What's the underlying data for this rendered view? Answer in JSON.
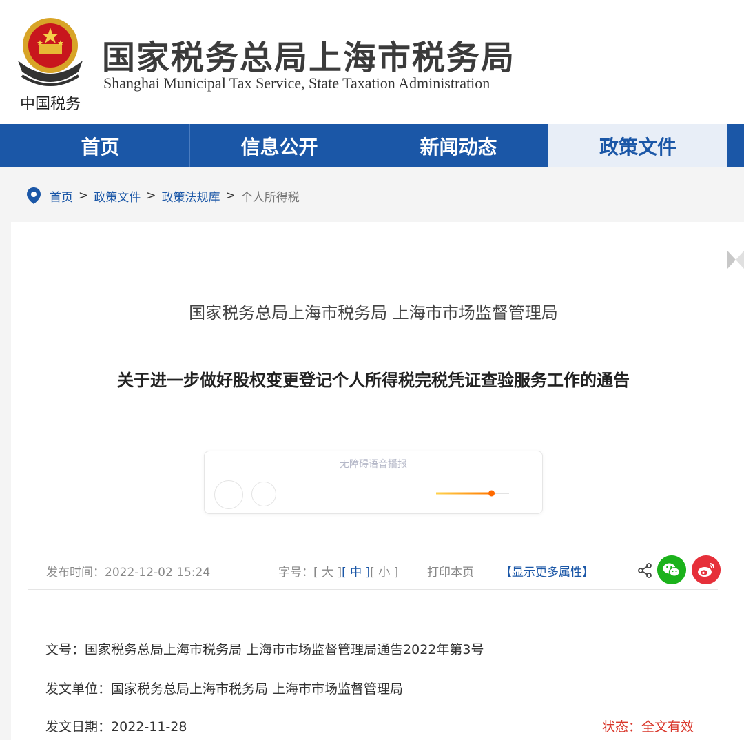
{
  "header": {
    "emblem_caption": "中国税务",
    "title": "国家税务总局上海市税务局",
    "subtitle": "Shanghai Municipal Tax Service, State Taxation Administration"
  },
  "nav": {
    "items": [
      {
        "label": "首页"
      },
      {
        "label": "信息公开"
      },
      {
        "label": "新闻动态"
      },
      {
        "label": "政策文件"
      }
    ],
    "active_index": 3
  },
  "breadcrumb": {
    "items": [
      "首页",
      "政策文件",
      "政策法规库"
    ],
    "separator": ">",
    "current": "个人所得税"
  },
  "article": {
    "issuer": "国家税务总局上海市税务局 上海市市场监督管理局",
    "title": "关于进一步做好股权变更登记个人所得税完税凭证查验服务工作的通告",
    "player_label": "无障碍语音播报",
    "player_progress": 0.76
  },
  "meta": {
    "publish_label": "发布时间：",
    "publish_time": "2022-12-02 15:24",
    "font_label": "字号：",
    "font_large": "[ 大 ]",
    "font_medium": "[ 中 ]",
    "font_small": "[ 小 ]",
    "print": "打印本页",
    "more": "【显示更多属性】"
  },
  "doc_info": {
    "number_label": "文号：",
    "number": "国家税务总局上海市税务局 上海市市场监督管理局通告2022年第3号",
    "unit_label": "发文单位：",
    "unit": "国家税务总局上海市税务局 上海市市场监督管理局",
    "date_label": "发文日期：",
    "date": "2022-11-28",
    "status_label": "状态：",
    "status": "全文有效"
  },
  "colors": {
    "brand_blue": "#1b57a7",
    "status_red": "#d9372b",
    "wechat_green": "#1bb21b",
    "weibo_red": "#e6303a"
  }
}
